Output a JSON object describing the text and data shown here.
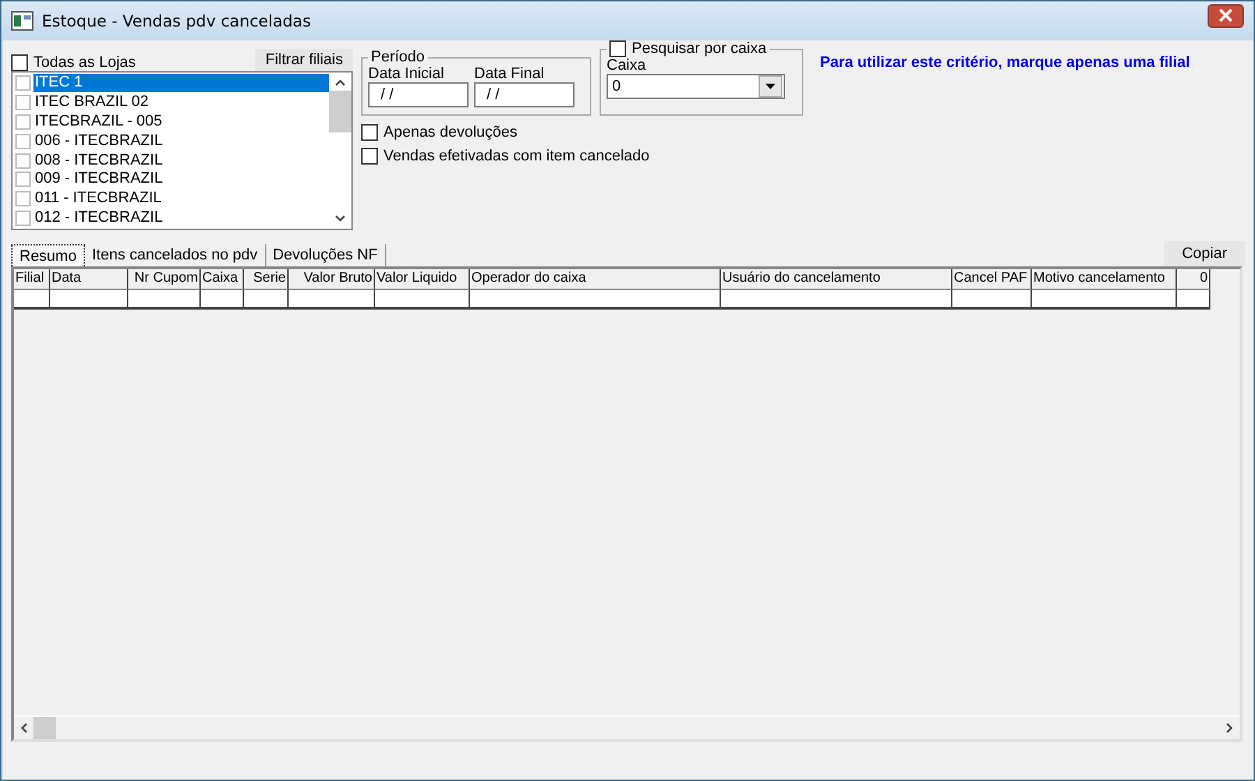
{
  "window": {
    "title": "Estoque - Vendas pdv canceladas"
  },
  "stores": {
    "all_label": "Todas as Lojas",
    "all_checked": false,
    "filter_button": "Filtrar filiais",
    "items": [
      {
        "label": "ITEC 1",
        "checked": false,
        "selected": true
      },
      {
        "label": "ITEC BRAZIL 02",
        "checked": false,
        "selected": false
      },
      {
        "label": "ITECBRAZIL - 005",
        "checked": false,
        "selected": false
      },
      {
        "label": "006 - ITECBRAZIL",
        "checked": false,
        "selected": false
      },
      {
        "label": "008 - ITECBRAZIL",
        "checked": false,
        "selected": false
      },
      {
        "label": "009 - ITECBRAZIL",
        "checked": false,
        "selected": false
      },
      {
        "label": "011 - ITECBRAZIL",
        "checked": false,
        "selected": false
      },
      {
        "label": "012 - ITECBRAZIL",
        "checked": false,
        "selected": false
      }
    ]
  },
  "period": {
    "title": "Período",
    "start_label": "Data Inicial",
    "start_value": "/ /",
    "end_label": "Data Final",
    "end_value": "/ /"
  },
  "options": [
    {
      "label": "Apenas devoluções",
      "checked": false
    },
    {
      "label": "Vendas efetivadas com item cancelado",
      "checked": false
    }
  ],
  "cash_search": {
    "label": "Pesquisar por caixa",
    "checked": false,
    "field_label": "Caixa",
    "value": "0"
  },
  "hint": "Para utilizar este critério,  marque apenas uma filial",
  "tabs": [
    {
      "label": "Resumo",
      "selected": true
    },
    {
      "label": "Itens cancelados no pdv",
      "selected": false
    },
    {
      "label": "Devoluções NF",
      "selected": false
    }
  ],
  "copy_button": "Copiar",
  "table": {
    "columns": [
      "Filial",
      "Data",
      "Nr Cupom",
      "Caixa",
      "Serie",
      "Valor Bruto",
      "Valor Liquido",
      "Operador do caixa",
      "Usuário do cancelamento",
      "Cancel PAF",
      "Motivo cancelamento",
      "0"
    ]
  }
}
